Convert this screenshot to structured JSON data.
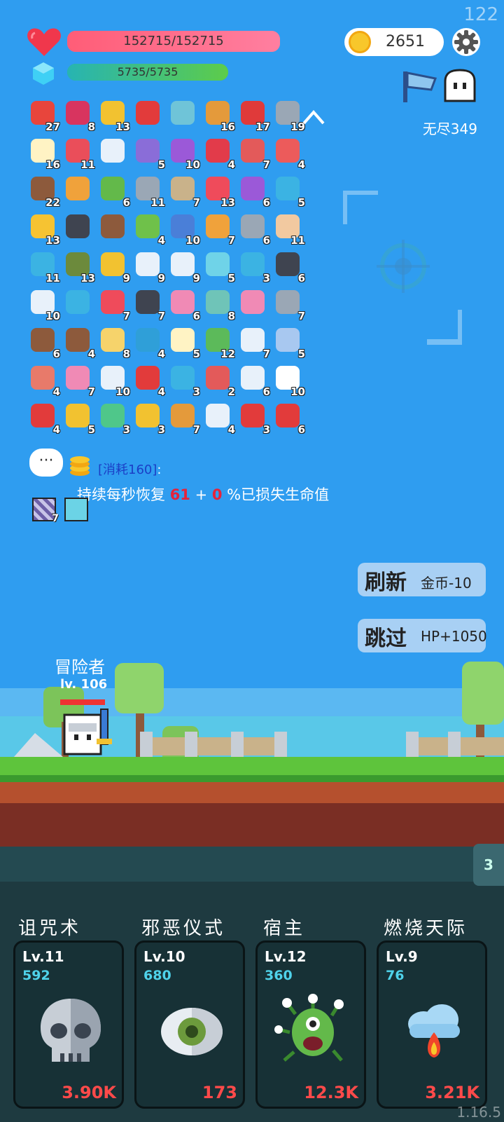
{
  "hud": {
    "fps": "122",
    "hp": "152715/152715",
    "mp": "5735/5735",
    "coins": "2651",
    "mode": "无尽349"
  },
  "items": [
    {
      "name": "sock",
      "count": "27",
      "color": "#e8453c"
    },
    {
      "name": "jam-jar",
      "count": "8",
      "color": "#d8345f"
    },
    {
      "name": "crown",
      "count": "13",
      "color": "#f2c230"
    },
    {
      "name": "magnet",
      "count": "",
      "color": "#e23b3b"
    },
    {
      "name": "magnifier",
      "count": "",
      "color": "#6fc4d8"
    },
    {
      "name": "book",
      "count": "16",
      "color": "#e49a3b"
    },
    {
      "name": "apple",
      "count": "17",
      "color": "#e03a3a"
    },
    {
      "name": "sword",
      "count": "19",
      "color": "#9aa7b5"
    },
    {
      "name": "flower",
      "count": "16",
      "color": "#fff3c4"
    },
    {
      "name": "watermelon",
      "count": "11",
      "color": "#ea4e5a"
    },
    {
      "name": "wing",
      "count": "",
      "color": "#e8f1fa"
    },
    {
      "name": "star-shield",
      "count": "5",
      "color": "#8a6dd8"
    },
    {
      "name": "box",
      "count": "10",
      "color": "#9b59d8"
    },
    {
      "name": "strawberry",
      "count": "4",
      "color": "#e23b4a"
    },
    {
      "name": "thermometer",
      "count": "7",
      "color": "#e35a5a"
    },
    {
      "name": "pill",
      "count": "4",
      "color": "#ec5b5b"
    },
    {
      "name": "shield-round",
      "count": "22",
      "color": "#8d5a3c"
    },
    {
      "name": "card",
      "count": "",
      "color": "#f0a23b"
    },
    {
      "name": "zombie",
      "count": "6",
      "color": "#63b94a"
    },
    {
      "name": "compass",
      "count": "11",
      "color": "#9aa7b5"
    },
    {
      "name": "meteor",
      "count": "7",
      "color": "#c9b28a"
    },
    {
      "name": "heart",
      "count": "13",
      "color": "#ef4b5b"
    },
    {
      "name": "crystal-ball",
      "count": "6",
      "color": "#9b59d8"
    },
    {
      "name": "speech",
      "count": "5",
      "color": "#3bb3e3"
    },
    {
      "name": "sun",
      "count": "13",
      "color": "#f6c332"
    },
    {
      "name": "skull-book",
      "count": "",
      "color": "#3f4450"
    },
    {
      "name": "chest",
      "count": "",
      "color": "#8d5a3c"
    },
    {
      "name": "lime",
      "count": "4",
      "color": "#6fc14a"
    },
    {
      "name": "blue-shield",
      "count": "10",
      "color": "#4a7fd8"
    },
    {
      "name": "scroll",
      "count": "7",
      "color": "#f0a23b"
    },
    {
      "name": "axe",
      "count": "6",
      "color": "#9aa7b5"
    },
    {
      "name": "fist",
      "count": "11",
      "color": "#f2c9a0"
    },
    {
      "name": "photo",
      "count": "11",
      "color": "#3bb3e3"
    },
    {
      "name": "grenade",
      "count": "13",
      "color": "#6c8a3c"
    },
    {
      "name": "sunflower",
      "count": "9",
      "color": "#f2c230"
    },
    {
      "name": "bulb",
      "count": "9",
      "color": "#e8f1fa"
    },
    {
      "name": "clipboard",
      "count": "9",
      "color": "#e8f1fa"
    },
    {
      "name": "potion",
      "count": "5",
      "color": "#6fd3e8"
    },
    {
      "name": "target",
      "count": "3",
      "color": "#3bb3e3"
    },
    {
      "name": "bat",
      "count": "6",
      "color": "#3f4450"
    },
    {
      "name": "milk",
      "count": "10",
      "color": "#e8f1fa"
    },
    {
      "name": "blue-scroll",
      "count": "",
      "color": "#3bb3e3"
    },
    {
      "name": "gift",
      "count": "7",
      "color": "#ef4b5b"
    },
    {
      "name": "pot",
      "count": "7",
      "color": "#3f4450"
    },
    {
      "name": "ice-cream",
      "count": "6",
      "color": "#f08ab5"
    },
    {
      "name": "disc",
      "count": "8",
      "color": "#6fc4b8"
    },
    {
      "name": "love-letter",
      "count": "",
      "color": "#f08ab5"
    },
    {
      "name": "mace",
      "count": "7",
      "color": "#9aa7b5"
    },
    {
      "name": "coconut",
      "count": "6",
      "color": "#8d5a3c"
    },
    {
      "name": "tombstone",
      "count": "4",
      "color": "#8d5a3c"
    },
    {
      "name": "note",
      "count": "8",
      "color": "#f6d36b"
    },
    {
      "name": "sapphire",
      "count": "4",
      "color": "#2f9fd8"
    },
    {
      "name": "egg",
      "count": "5",
      "color": "#fff3c4"
    },
    {
      "name": "cash",
      "count": "12",
      "color": "#5cba5a"
    },
    {
      "name": "dice",
      "count": "7",
      "color": "#e8f1fa"
    },
    {
      "name": "capsule",
      "count": "5",
      "color": "#a8c8f0"
    },
    {
      "name": "meat",
      "count": "4",
      "color": "#e87a6a"
    },
    {
      "name": "syringe",
      "count": "7",
      "color": "#f08ab5"
    },
    {
      "name": "mail",
      "count": "10",
      "color": "#e8f1fa"
    },
    {
      "name": "hearts",
      "count": "4",
      "color": "#e23b3b"
    },
    {
      "name": "mustache",
      "count": "3",
      "color": "#3bb3e3"
    },
    {
      "name": "hook",
      "count": "2",
      "color": "#e35a5a"
    },
    {
      "name": "cloud",
      "count": "6",
      "color": "#e8f1fa"
    },
    {
      "name": "ghost",
      "count": "10",
      "color": "#ffffff"
    },
    {
      "name": "ribbon",
      "count": "4",
      "color": "#e23b3b"
    },
    {
      "name": "ring",
      "count": "5",
      "color": "#f2c230"
    },
    {
      "name": "green-person",
      "count": "3",
      "color": "#4fc78a"
    },
    {
      "name": "wand",
      "count": "3",
      "color": "#f2c230"
    },
    {
      "name": "bow",
      "count": "7",
      "color": "#e49a3b"
    },
    {
      "name": "cards",
      "count": "4",
      "color": "#e8f1fa"
    },
    {
      "name": "red-shield",
      "count": "3",
      "color": "#e23b3b"
    },
    {
      "name": "mushroom",
      "count": "6",
      "color": "#e23b3b"
    }
  ],
  "skill_desc": {
    "cost_tag": "[消耗160]",
    "colon": ":",
    "desc_prefix": "持续每秒恢复 ",
    "value_a": "61",
    "plus": " + ",
    "value_b": "0",
    "desc_suffix": " %已损失生命值",
    "small_count": "7"
  },
  "actions": {
    "refresh_main": "刷新",
    "refresh_sub": "金币-10",
    "skip_main": "跳过",
    "skip_sub": "HP+1050"
  },
  "hero": {
    "name": "冒险者",
    "level": "lv. 106"
  },
  "wave_tab": "3",
  "skills": [
    {
      "title": "诅咒术",
      "level": "Lv.11",
      "cost": "592",
      "damage": "3.90K",
      "icon": "skull-icon"
    },
    {
      "title": "邪恶仪式",
      "level": "Lv.10",
      "cost": "680",
      "damage": "173",
      "icon": "eye-icon"
    },
    {
      "title": "宿主",
      "level": "Lv.12",
      "cost": "360",
      "damage": "12.3K",
      "icon": "germ-icon"
    },
    {
      "title": "燃烧天际",
      "level": "Lv.9",
      "cost": "76",
      "damage": "3.21K",
      "icon": "fire-cloud-icon"
    }
  ],
  "version": "1.16.5",
  "colors": {
    "sky": "#2f9df0",
    "hp": "#ff5d77",
    "mp": "#3cb36d",
    "cost": "#4fd2ea",
    "damage": "#ff4a4a"
  }
}
